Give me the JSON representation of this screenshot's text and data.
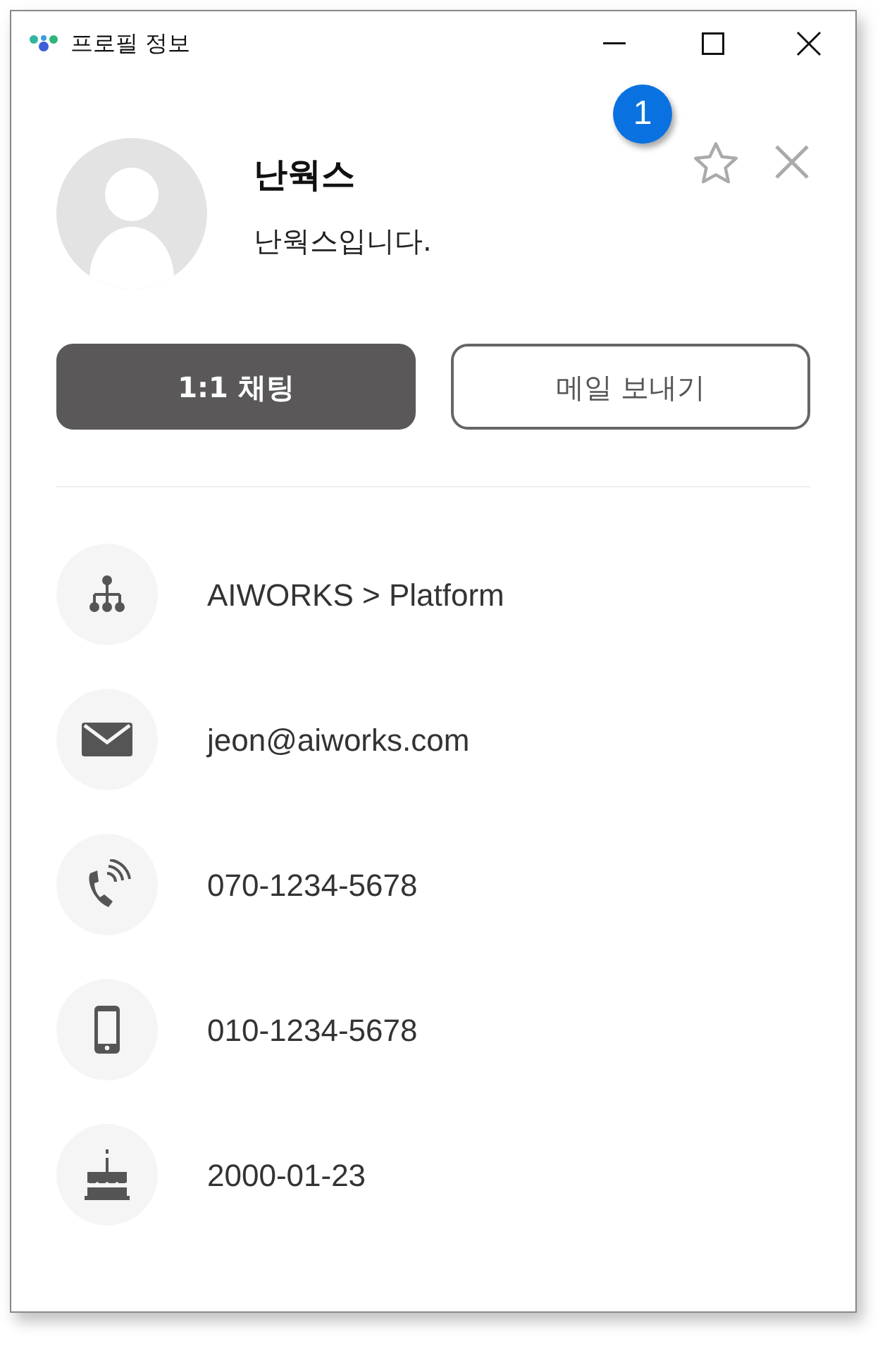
{
  "window": {
    "title": "프로필 정보"
  },
  "callout": "1",
  "profile": {
    "name": "난웍스",
    "status": "난웍스입니다.",
    "favorite": false
  },
  "buttons": [
    {
      "label": "1:1 채팅",
      "kind": "primary"
    },
    {
      "label": "메일 보내기",
      "kind": "secondary"
    }
  ],
  "details": [
    {
      "kind": "org",
      "text": "AIWORKS > Platform"
    },
    {
      "kind": "email",
      "text": "jeon@aiworks.com"
    },
    {
      "kind": "phone",
      "text": "070-1234-5678"
    },
    {
      "kind": "mobile",
      "text": "010-1234-5678"
    },
    {
      "kind": "birthday",
      "text": "2000-01-23"
    }
  ]
}
